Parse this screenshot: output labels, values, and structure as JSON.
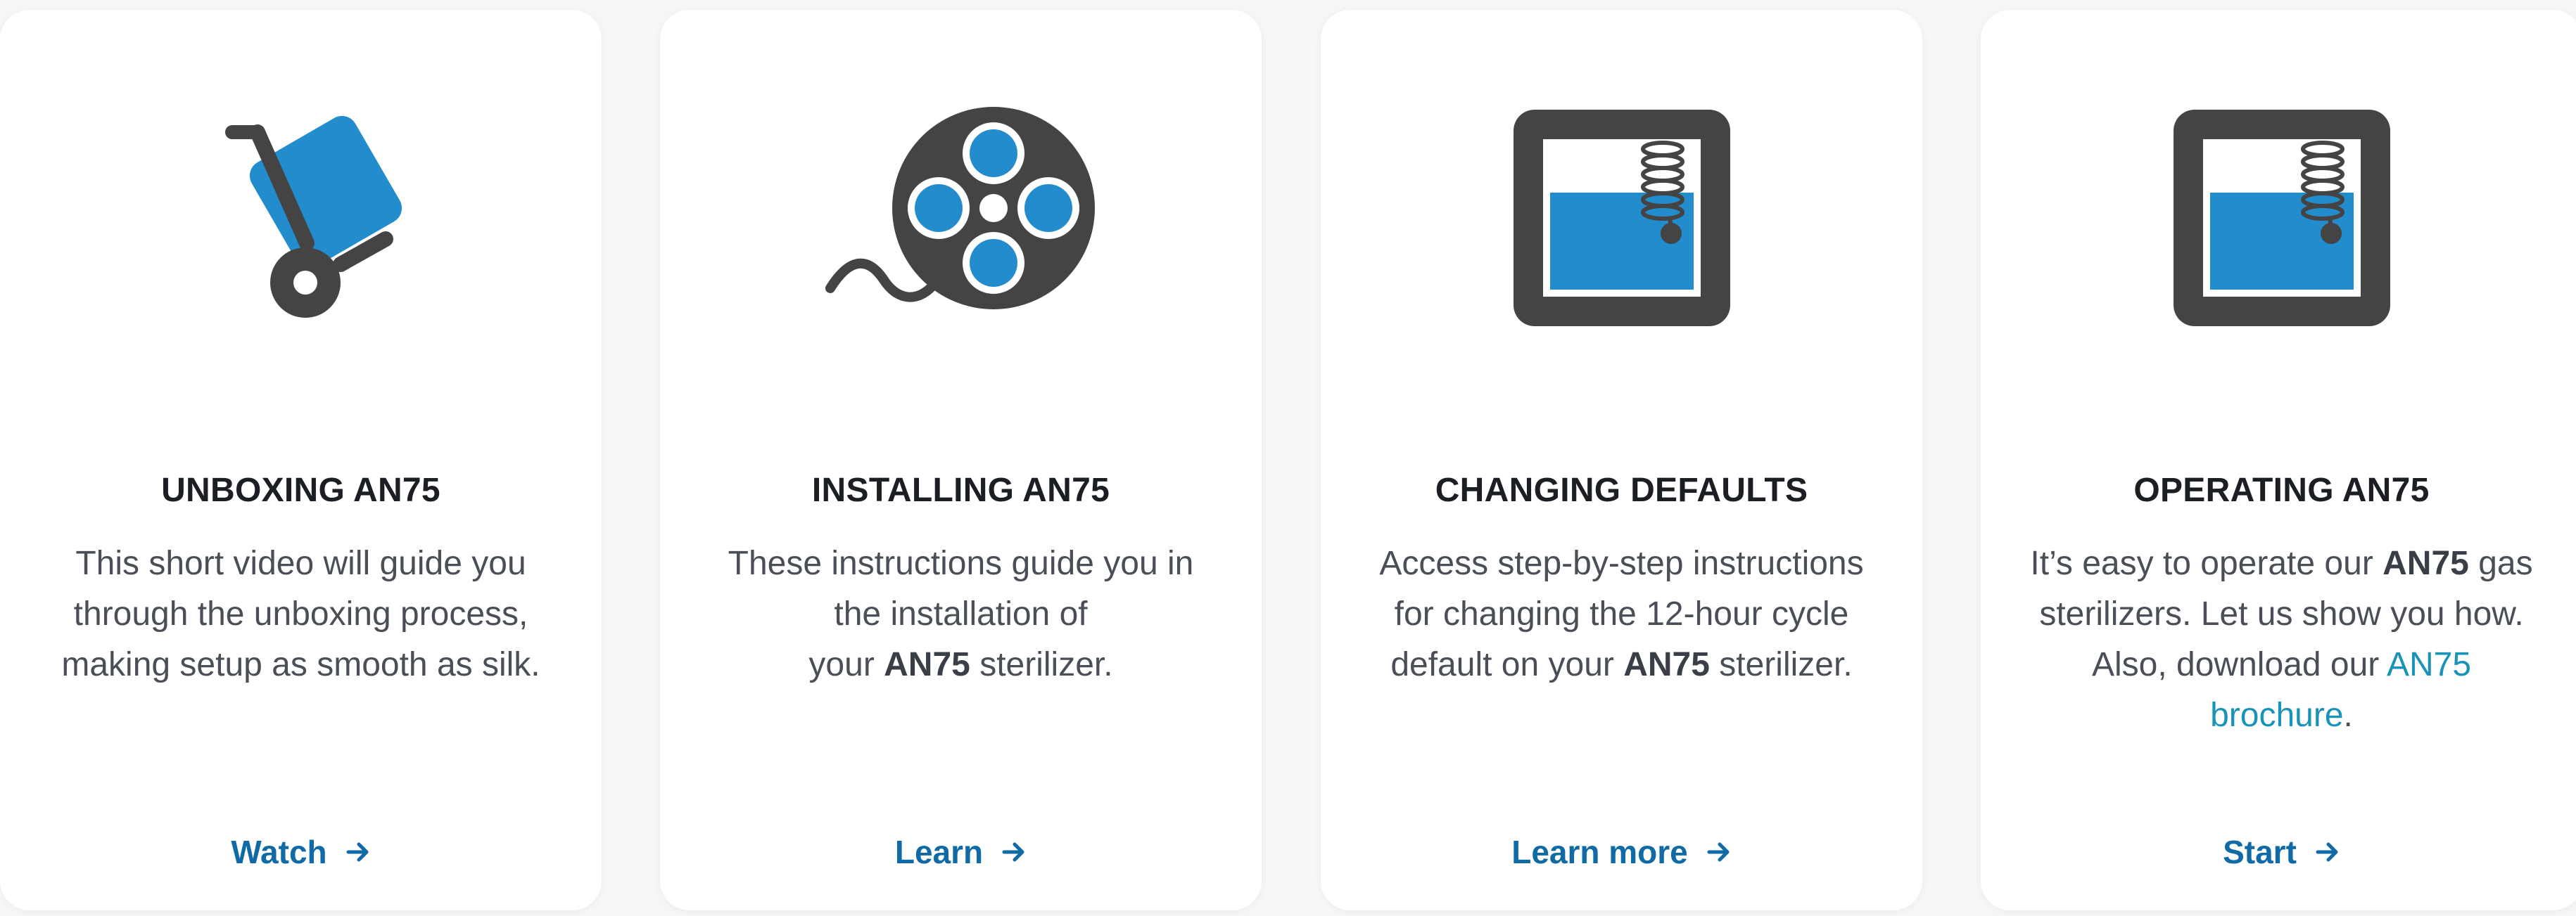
{
  "colors": {
    "icon_dark": "#444444",
    "icon_accent": "#238ccc",
    "title": "#1b1f24",
    "text": "#4a4f57",
    "cta": "#0f6aa6",
    "link": "#1a93b8"
  },
  "cards": [
    {
      "icon": "hand-truck-icon",
      "title": "UNBOXING AN75",
      "desc_lines": [
        "This short video will guide you",
        "through the unboxing process,",
        "making setup as smooth as silk."
      ],
      "cta": "Watch"
    },
    {
      "icon": "film-reel-icon",
      "title": "INSTALLING AN75",
      "desc_line1": "These instructions guide you in",
      "desc_line2": "the installation of",
      "desc_line3_before": "your ",
      "desc_line3_bold": "AN75",
      "desc_line3_after": " sterilizer.",
      "cta": "Learn"
    },
    {
      "icon": "sterilizer-chamber-icon",
      "title": "CHANGING DEFAULTS",
      "desc_line1": "Access step-by-step instructions",
      "desc_line2": "for changing the 12-hour cycle",
      "desc_line3_before": "default on your ",
      "desc_line3_bold": "AN75",
      "desc_line3_after": " sterilizer.",
      "cta": "Learn more"
    },
    {
      "icon": "sterilizer-chamber-icon",
      "title": "OPERATING AN75",
      "desc_line1_before": "It’s easy to operate our ",
      "desc_line1_bold": "AN75",
      "desc_line1_after": " gas",
      "desc_line2": "sterilizers. Let us show you how.",
      "desc_line3_before": "Also, download our ",
      "desc_line3_link": "AN75",
      "desc_line4_link": "brochure",
      "desc_line4_after": ".",
      "cta": "Start"
    }
  ]
}
